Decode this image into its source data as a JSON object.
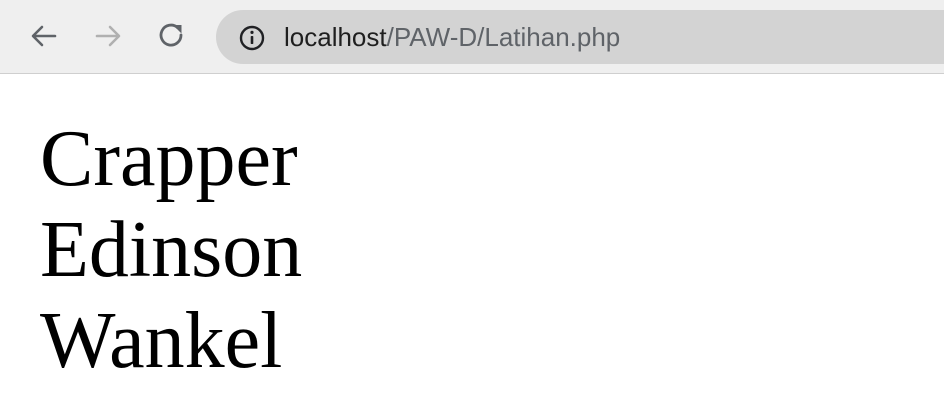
{
  "browser": {
    "url_host": "localhost",
    "url_path": "/PAW-D/Latihan.php",
    "icons": {
      "back": "arrow-left-icon",
      "forward": "arrow-right-icon",
      "reload": "reload-icon",
      "info": "info-icon"
    }
  },
  "page": {
    "lines": [
      "Crapper",
      "Edinson",
      "Wankel"
    ]
  }
}
